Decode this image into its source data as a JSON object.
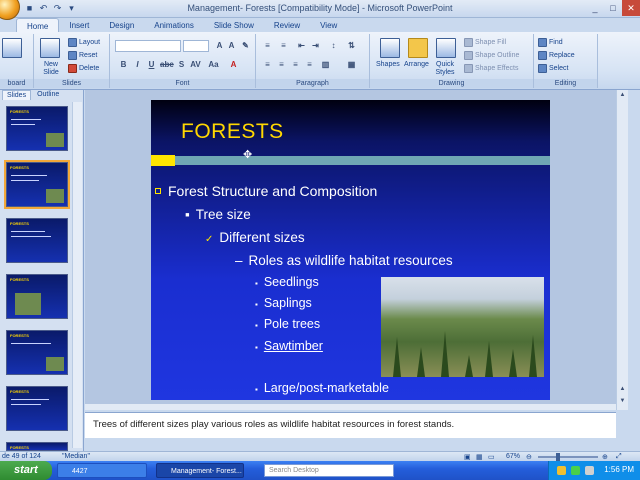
{
  "window": {
    "title": "Management- Forests [Compatibility Mode] - Microsoft PowerPoint"
  },
  "ribbon_tabs": [
    "Home",
    "Insert",
    "Design",
    "Animations",
    "Slide Show",
    "Review",
    "View"
  ],
  "ribbon": {
    "clipboard": {
      "label": "board"
    },
    "slides": {
      "new_slide": "New Slide",
      "layout": "Layout",
      "reset": "Reset",
      "delete": "Delete",
      "label": "Slides"
    },
    "font": {
      "label": "Font"
    },
    "paragraph": {
      "label": "Paragraph"
    },
    "drawing": {
      "shapes": "Shapes",
      "arrange": "Arrange",
      "quick_styles": "Quick Styles",
      "shape_fill": "Shape Fill",
      "shape_outline": "Shape Outline",
      "shape_effects": "Shape Effects",
      "label": "Drawing"
    },
    "editing": {
      "find": "Find",
      "replace": "Replace",
      "select": "Select",
      "label": "Editing"
    }
  },
  "panel_tabs": [
    "Slides",
    "Outline"
  ],
  "thumbnails": [
    {
      "num": "",
      "title": "FORESTS"
    },
    {
      "num": "",
      "title": "FORESTS"
    },
    {
      "num": "",
      "title": "FORESTS"
    },
    {
      "num": "",
      "title": "FORESTS"
    },
    {
      "num": "",
      "title": "FORESTS"
    },
    {
      "num": "",
      "title": "FORESTS"
    },
    {
      "num": "",
      "title": "FORESTS"
    }
  ],
  "slide": {
    "title": "FORESTS",
    "bullet1": "Forest Structure and Composition",
    "bullet2": "Tree size",
    "bullet3": "Different sizes",
    "bullet4": "Roles as wildlife habitat resources",
    "items": [
      "Seedlings",
      "Saplings",
      "Pole trees",
      "Sawtimber",
      "Large/post-marketable"
    ]
  },
  "notes": "Trees of different sizes play various roles as wildlife habitat resources in forest stands.",
  "status": {
    "slide_info": "de 49 of 124",
    "theme": "\"Median\"",
    "zoom": "67%"
  },
  "taskbar": {
    "start": "start",
    "task1": "4427",
    "task2": "Management- Forest...",
    "search_placeholder": "Search Desktop",
    "clock": "1:56 PM"
  },
  "colors": {
    "slide_title": "#ffd700",
    "slide_bg": "#1a2ed0",
    "accent_bar": "#6fa6b4"
  }
}
